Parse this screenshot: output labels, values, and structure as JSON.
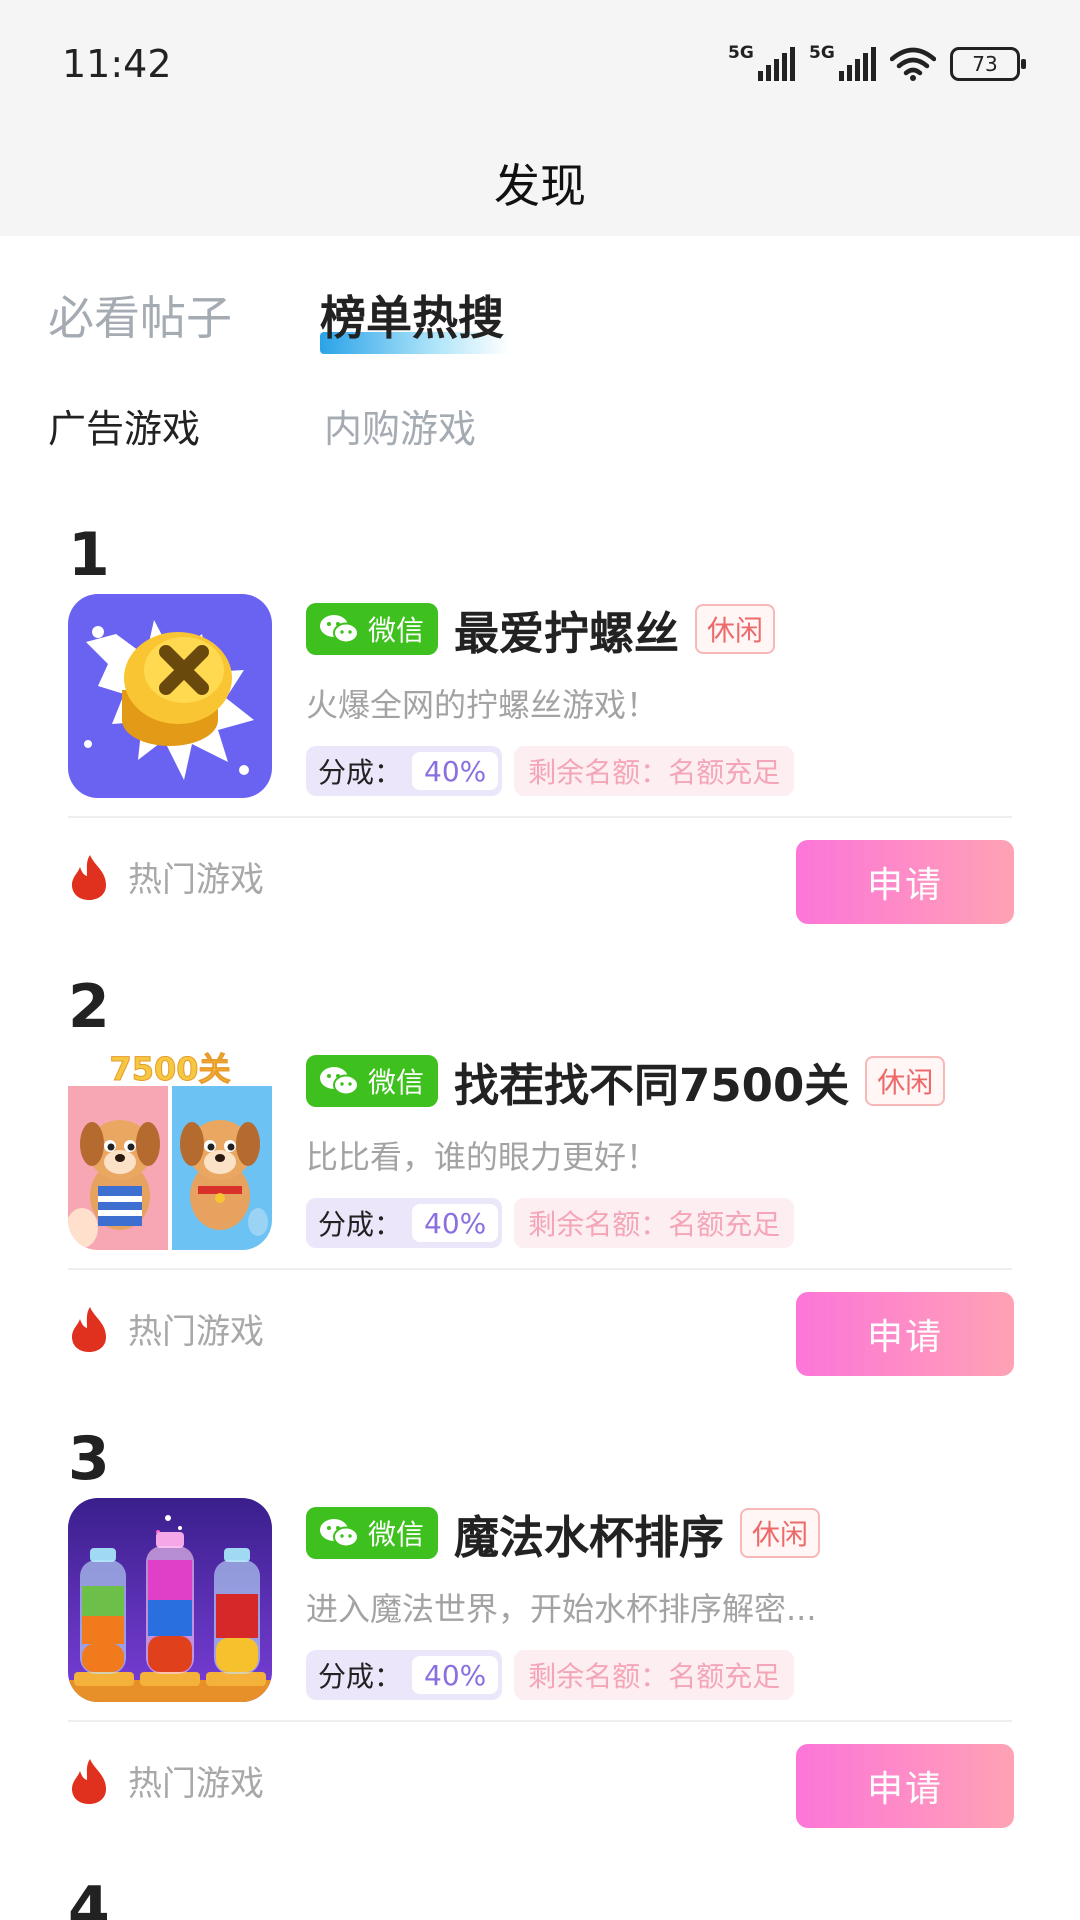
{
  "status_bar": {
    "time": "11:42",
    "network_1": "5G",
    "network_2": "5G",
    "battery": "73"
  },
  "header": {
    "title": "发现"
  },
  "tabs": [
    {
      "label": "必看帖子",
      "active": false
    },
    {
      "label": "榜单热搜",
      "active": true
    }
  ],
  "subtabs": [
    {
      "label": "广告游戏",
      "active": true
    },
    {
      "label": "内购游戏",
      "active": false
    }
  ],
  "games": [
    {
      "rank": "1",
      "platform": "微信",
      "name": "最爱拧螺丝",
      "genre": "休闲",
      "description": "火爆全网的拧螺丝游戏！",
      "share_label": "分成：",
      "share_value": "40%",
      "quota": "剩余名额：名额充足",
      "hot_label": "热门游戏",
      "apply_label": "申请",
      "thumb": "screw-game-icon"
    },
    {
      "rank": "2",
      "platform": "微信",
      "name": "找茬找不同7500关",
      "genre": "休闲",
      "description": "比比看，谁的眼力更好！",
      "share_label": "分成：",
      "share_value": "40%",
      "quota": "剩余名额：名额充足",
      "hot_label": "热门游戏",
      "apply_label": "申请",
      "thumb": "spot-difference-dog-icon",
      "thumb_text": "7500关"
    },
    {
      "rank": "3",
      "platform": "微信",
      "name": "魔法水杯排序",
      "genre": "休闲",
      "description": "进入魔法世界，开始水杯排序解密...",
      "share_label": "分成：",
      "share_value": "40%",
      "quota": "剩余名额：名额充足",
      "hot_label": "热门游戏",
      "apply_label": "申请",
      "thumb": "water-sort-bottles-icon"
    }
  ],
  "next_rank": "4",
  "colors": {
    "wechat_green": "#3ec11e",
    "apply_gradient_start": "#fd75d9",
    "apply_gradient_end": "#fea2b4",
    "share_purple": "#8b6fe0"
  }
}
